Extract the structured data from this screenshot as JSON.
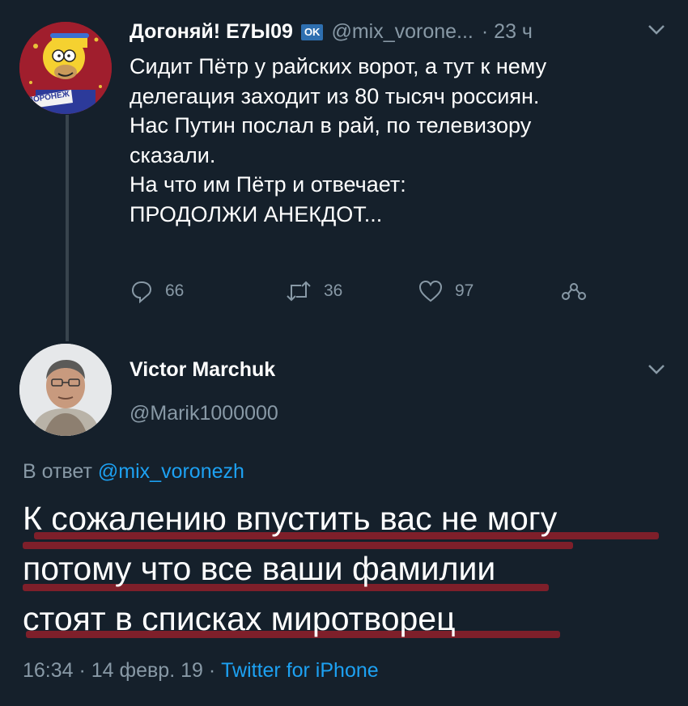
{
  "tweet1": {
    "display_name": "Догоняй! Е7Ы09",
    "badge": "OK",
    "handle": "@mix_vorone...",
    "time": "· 23 ч",
    "avatar_caption": "ВОРОНЕЖ",
    "lines": [
      "Сидит Пётр у райских ворот, а тут к нему",
      "делегация заходит из 80 тысяч россиян.",
      "Нас Путин послал в рай, по телевизору",
      "сказали.",
      "На что им Пётр и отвечает:",
      "ПРОДОЛЖИ АНЕКДОТ..."
    ],
    "actions": {
      "replies": "66",
      "retweets": "36",
      "likes": "97"
    }
  },
  "tweet2": {
    "display_name": "Victor Marchuk",
    "handle": "@Marik1000000",
    "reply_prefix": "В ответ",
    "reply_to": "@mix_voronezh",
    "lines": [
      "К сожалению впустить вас не могу",
      "потому что все ваши фамилии",
      "стоят в списках миротворец"
    ],
    "timestamp": "16:34 · 14 февр. 19 ·",
    "source": "Twitter for iPhone"
  },
  "colors": {
    "background": "#15202b",
    "muted": "#8899a6",
    "link": "#1da1f2",
    "strike": "#8a1f2a"
  }
}
